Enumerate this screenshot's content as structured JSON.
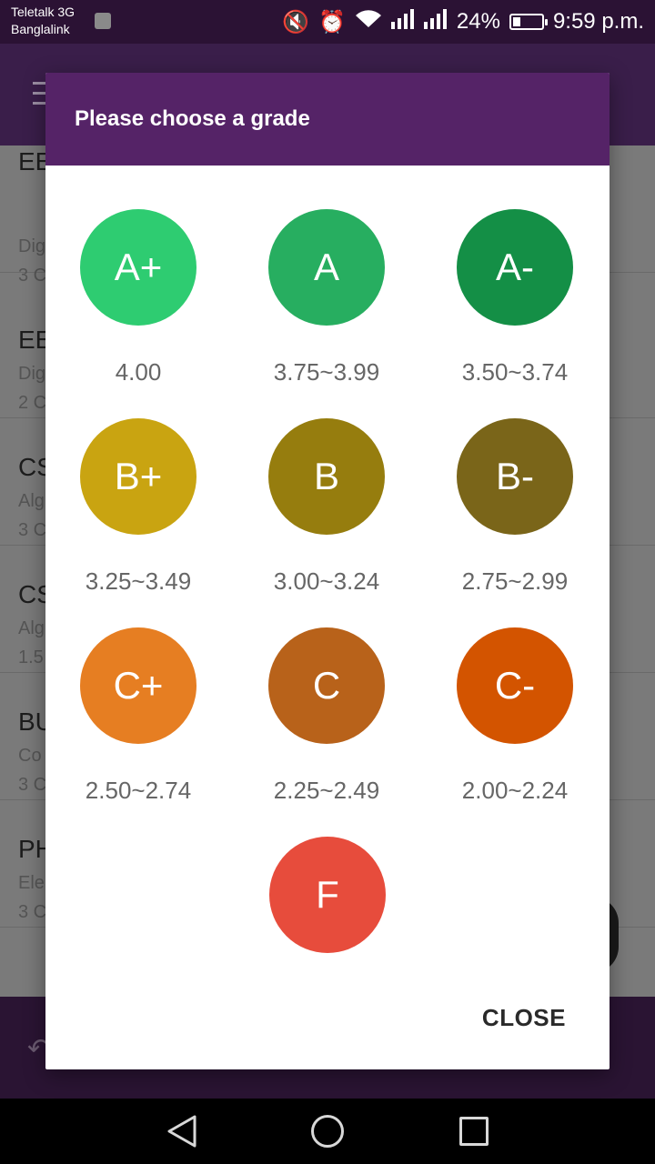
{
  "status_bar": {
    "carrier1": "Teletalk 3G",
    "carrier2": "Banglalink",
    "battery": "24%",
    "time": "9:59 p.m."
  },
  "courses": [
    {
      "code": "EE",
      "name": "Dig",
      "credit": "3 C"
    },
    {
      "code": "EE",
      "name": "Dig",
      "credit": "2 C"
    },
    {
      "code": "CS",
      "name": "Alg",
      "credit": "3 C"
    },
    {
      "code": "CS",
      "name": "Alg",
      "credit": "1.5"
    },
    {
      "code": "BU",
      "name": "Co",
      "credit": "3 C"
    },
    {
      "code": "PH",
      "name": "Ele",
      "credit": "3 C"
    }
  ],
  "dialog": {
    "title": "Please choose a grade",
    "close_label": "CLOSE",
    "grades": [
      {
        "label": "A+",
        "range": "4.00",
        "color": "#2ecc71"
      },
      {
        "label": "A",
        "range": "3.75~3.99",
        "color": "#27ae60"
      },
      {
        "label": "A-",
        "range": "3.50~3.74",
        "color": "#148f46"
      },
      {
        "label": "B+",
        "range": "3.25~3.49",
        "color": "#c9a411"
      },
      {
        "label": "B",
        "range": "3.00~3.24",
        "color": "#967d0e"
      },
      {
        "label": "B-",
        "range": "2.75~2.99",
        "color": "#7a6519"
      },
      {
        "label": "C+",
        "range": "2.50~2.74",
        "color": "#e67e22"
      },
      {
        "label": "C",
        "range": "2.25~2.49",
        "color": "#b8621a"
      },
      {
        "label": "C-",
        "range": "2.00~2.24",
        "color": "#d35400"
      },
      {
        "label": "F",
        "range": "",
        "color": "#e74c3c"
      }
    ]
  }
}
